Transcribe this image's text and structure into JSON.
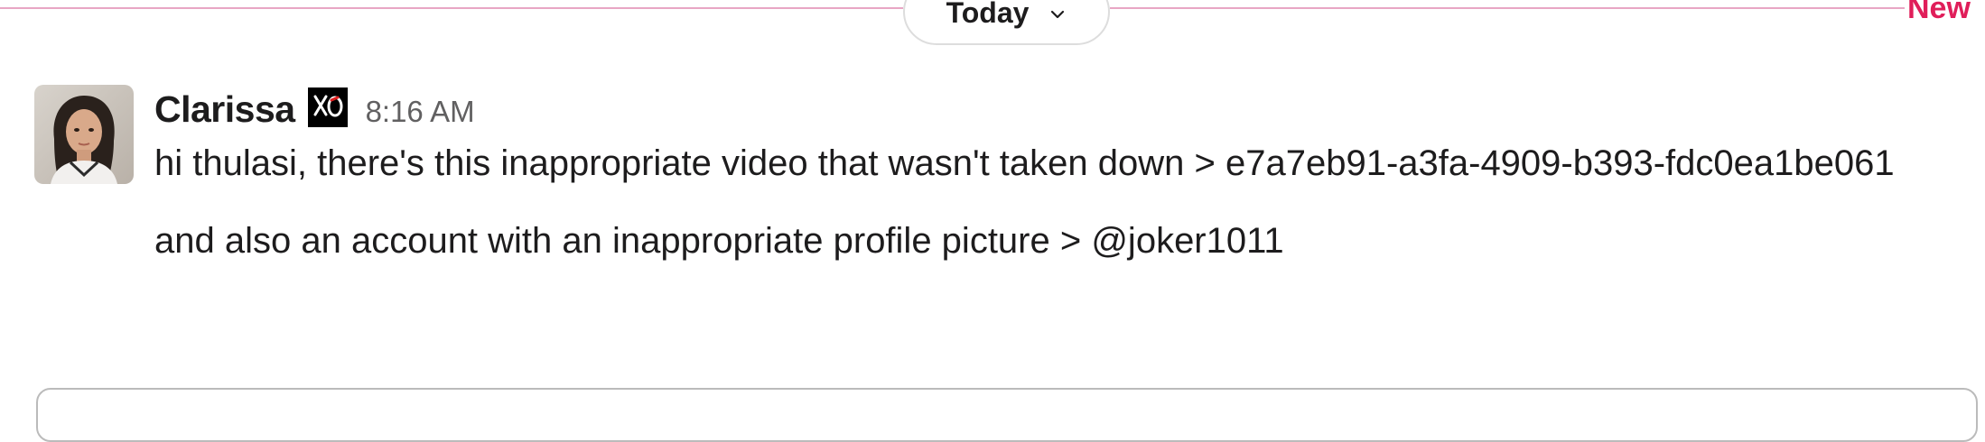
{
  "divider": {
    "date_label": "Today",
    "new_label": "New",
    "line_color": "#e8a6c4",
    "new_color": "#e01e5a",
    "chevron_icon": "chevron-down-icon"
  },
  "message": {
    "author": "Clarissa",
    "status_emoji": "xo-emoji",
    "timestamp": "8:16 AM",
    "paragraphs": [
      "hi thulasi, there's this inappropriate video that wasn't taken down > e7a7eb91-a3fa-4909-b393-fdc0ea1be061",
      "and also an account with an inappropriate profile picture > @joker1011"
    ]
  }
}
